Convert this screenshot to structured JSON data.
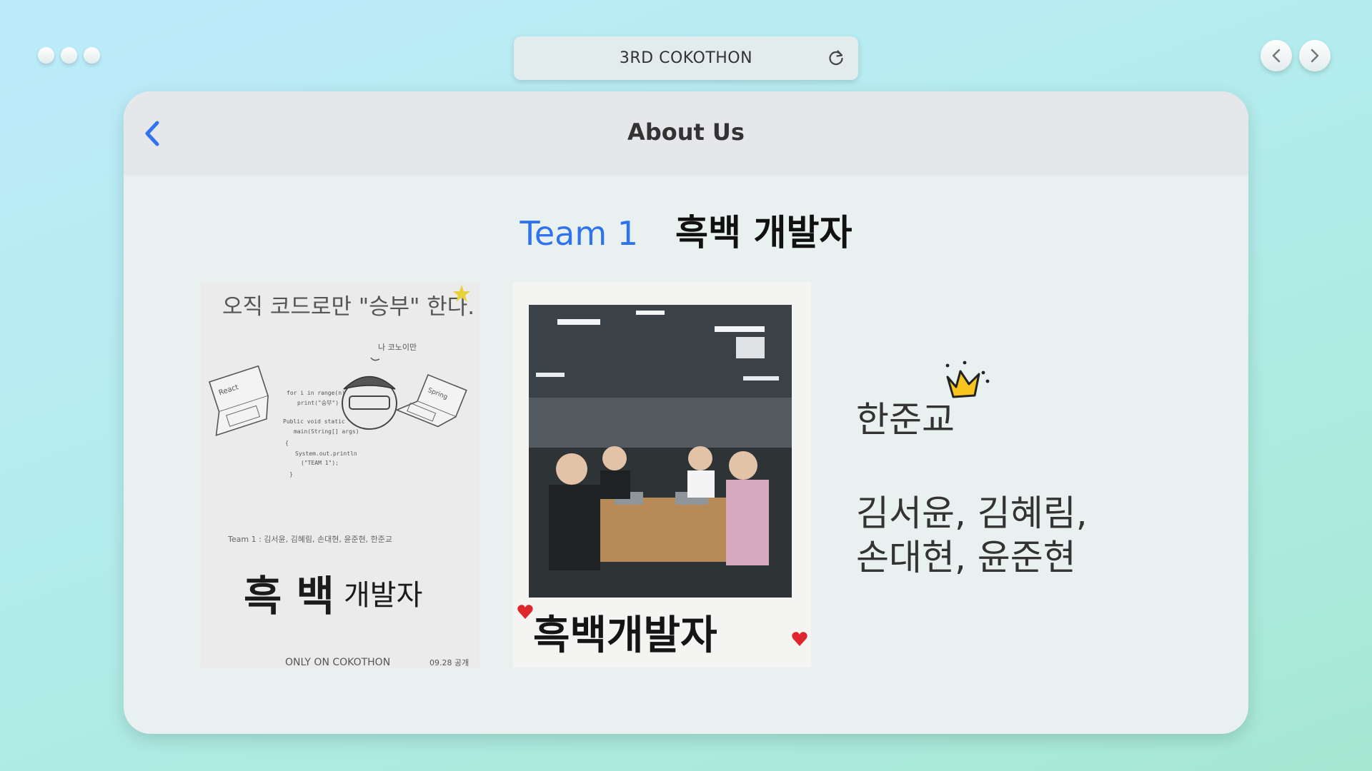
{
  "browser": {
    "address_text": "3RD COKOTHON",
    "reload_icon": "reload-icon",
    "back_icon": "chevron-left-icon",
    "forward_icon": "chevron-right-icon"
  },
  "window": {
    "title": "About Us",
    "back_icon": "chevron-left-icon"
  },
  "team": {
    "label": "Team 1",
    "name": "흑백 개발자",
    "leader": "한준교",
    "leader_icon": "crown-icon",
    "members_line1": "김서윤, 김혜림,",
    "members_line2": "손대현, 윤준현"
  },
  "poster": {
    "headline": "오직 코드로만 \"승부\" 한다.",
    "bubble_text": "나 코노이만",
    "laptop_left_label": "React",
    "laptop_right_label": "Spring",
    "code_lines": [
      "for i in range(n)",
      "print(\"승부\")",
      "Public void static",
      "main(String[] args)",
      "{",
      "System.out.println",
      "(\"TEAM 1\");",
      "}"
    ],
    "team_line": "Team 1 : 김서윤, 김혜림, 손대현, 윤준현, 한준교",
    "big_title_part1": "흑 백",
    "big_title_part2": "개발자",
    "footer_left": "ONLY ON COKOTHON",
    "footer_right": "09.28 공개"
  },
  "polaroid": {
    "caption": "흑백개발자"
  },
  "colors": {
    "accent_blue": "#2f73f0",
    "crown_yellow": "#f7c51e",
    "heart_red": "#e0262d"
  }
}
